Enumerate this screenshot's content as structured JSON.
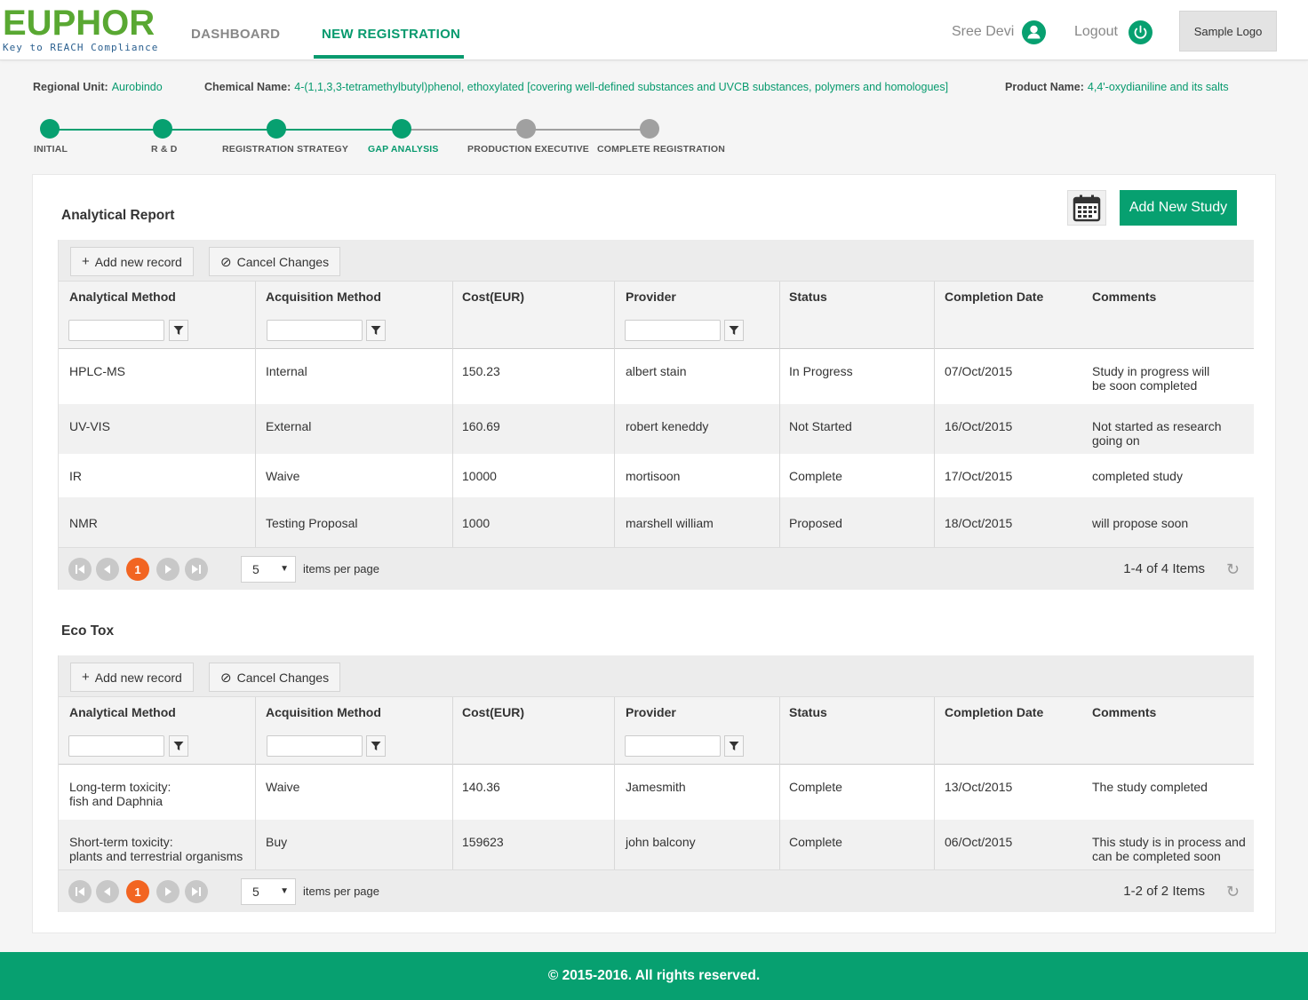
{
  "header": {
    "logo_name": "EUPHOR",
    "logo_tagline": "Key to REACH Compliance",
    "nav": [
      {
        "label": "DASHBOARD"
      },
      {
        "label": "NEW REGISTRATION"
      }
    ],
    "user_name": "Sree Devi",
    "logout_label": "Logout",
    "sample_logo": "Sample  Logo"
  },
  "info": {
    "regional_unit_label": "Regional Unit:",
    "regional_unit": "Aurobindo",
    "chemical_name_label": "Chemical Name:",
    "chemical_name": "4-(1,1,3,3-tetramethylbutyl)phenol, ethoxylated [covering well-defined substances and UVCB substances, polymers and homologues]",
    "product_name_label": "Product Name:",
    "product_name": "4,4'-oxydianiline and its salts"
  },
  "steps": [
    {
      "label": "INITIAL",
      "state": "done"
    },
    {
      "label": "R & D",
      "state": "done"
    },
    {
      "label": "REGISTRATION STRATEGY",
      "state": "done"
    },
    {
      "label": "GAP ANALYSIS",
      "state": "active"
    },
    {
      "label": "PRODUCTION EXECUTIVE",
      "state": "pending"
    },
    {
      "label": "COMPLETE REGISTRATION",
      "state": "pending"
    }
  ],
  "add_new_study": "Add New Study",
  "toolbar": {
    "add_record": "Add new record",
    "cancel_changes": "Cancel Changes"
  },
  "columns": [
    "Analytical Method",
    "Acquisition Method",
    "Cost(EUR)",
    "Provider",
    "Status",
    "Completion Date",
    "Comments"
  ],
  "pager": {
    "page": "1",
    "page_size": "5",
    "items_per_page": "items per page"
  },
  "analytical": {
    "title": "Analytical Report",
    "rows": [
      [
        "HPLC-MS",
        "Internal",
        "150.23",
        "albert stain",
        "In Progress",
        "07/Oct/2015",
        "Study in progress will\nbe soon completed"
      ],
      [
        "UV-VIS",
        "External",
        "160.69",
        "robert keneddy",
        "Not Started",
        "16/Oct/2015",
        "Not started as research\ngoing on"
      ],
      [
        "IR",
        "Waive",
        "10000",
        "mortisoon",
        "Complete",
        "17/Oct/2015",
        "completed study"
      ],
      [
        "NMR",
        "Testing Proposal",
        "1000",
        "marshell william",
        "Proposed",
        "18/Oct/2015",
        "will propose soon"
      ]
    ],
    "items_info": "1-4 of 4 Items"
  },
  "ecotox": {
    "title": "Eco Tox",
    "rows": [
      [
        "Long-term toxicity:\nfish and Daphnia",
        "Waive",
        "140.36",
        "Jamesmith",
        "Complete",
        "13/Oct/2015",
        "The study completed"
      ],
      [
        "Short-term toxicity:\nplants and terrestrial organisms",
        "Buy",
        "159623",
        "john balcony",
        "Complete",
        "06/Oct/2015",
        "This study is in process and\ncan be completed soon"
      ]
    ],
    "items_info": "1-2 of 2 Items"
  },
  "footer": "© 2015-2016. All rights reserved.",
  "colors": {
    "brand_green": "#07a070",
    "logo_green": "#59a832",
    "page_orange": "#f26522",
    "pending_gray": "#a0a0a0"
  }
}
